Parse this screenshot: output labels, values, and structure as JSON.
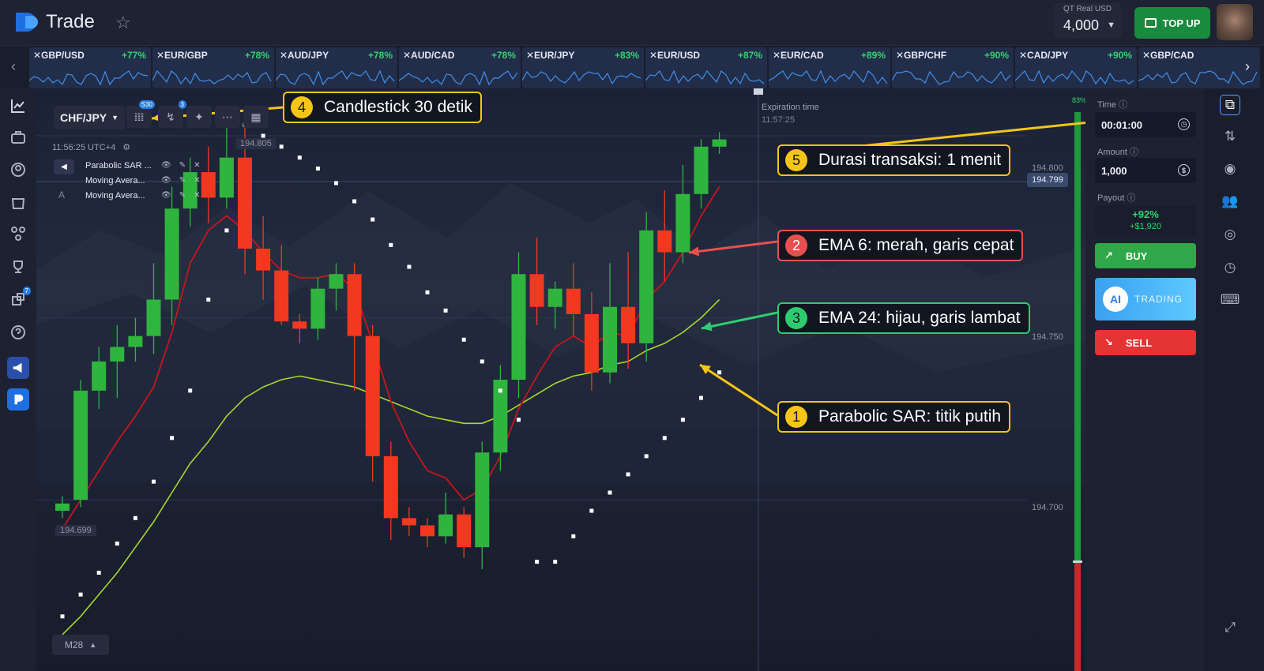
{
  "header": {
    "brand": "Trade",
    "account": {
      "label": "QT Real  USD",
      "balance": "4,000"
    },
    "topup_label": "TOP UP"
  },
  "assets": [
    {
      "name": "GBP/USD",
      "pct": "+77%"
    },
    {
      "name": "EUR/GBP",
      "pct": "+78%"
    },
    {
      "name": "AUD/JPY",
      "pct": "+78%"
    },
    {
      "name": "AUD/CAD",
      "pct": "+78%"
    },
    {
      "name": "EUR/JPY",
      "pct": "+83%"
    },
    {
      "name": "EUR/USD",
      "pct": "+87%"
    },
    {
      "name": "EUR/CAD",
      "pct": "+89%"
    },
    {
      "name": "GBP/CHF",
      "pct": "+90%"
    },
    {
      "name": "CAD/JPY",
      "pct": "+90%"
    },
    {
      "name": "GBP/CAD",
      "pct": ""
    }
  ],
  "sidebar_badges": {
    "notify1": "",
    "notify2": "",
    "count": "7"
  },
  "chart": {
    "pair": "CHF/JPY",
    "tool_badge_1": "S30",
    "tool_badge_2": "3",
    "clock": "11:56:25 UTC+4",
    "indicators": [
      "Parabolic SAR ...",
      "Moving Avera...",
      "Moving Avera..."
    ],
    "indicator_letter": "A",
    "high_tag": "194.805",
    "low_tag": "194.699",
    "current_price": "194.799",
    "price_levels": [
      "194.800",
      "194.750",
      "194.700"
    ],
    "expiration": {
      "label": "Expiration time",
      "time": "11:57:25"
    },
    "timeframe": "M28",
    "sentiment_pct": "83%"
  },
  "annotations": [
    {
      "num": "4",
      "text": "Candlestick 30 detik",
      "color": "#f5c518"
    },
    {
      "num": "5",
      "text": "Durasi transaksi: 1 menit",
      "color": "#f5c518"
    },
    {
      "num": "2",
      "text": "EMA 6: merah, garis cepat",
      "color": "#e85050"
    },
    {
      "num": "3",
      "text": "EMA 24: hijau, garis lambat",
      "color": "#2ecc71"
    },
    {
      "num": "1",
      "text": "Parabolic SAR: titik putih",
      "color": "#f5c518"
    }
  ],
  "trade_panel": {
    "time_label": "Time",
    "time_value": "00:01:00",
    "amount_label": "Amount",
    "amount_value": "1,000",
    "payout_label": "Payout",
    "payout_pct": "+92%",
    "payout_amount": "+$1,920",
    "buy_label": "BUY",
    "ai_label": "AI",
    "ai_sub": "TRADING",
    "sell_label": "SELL"
  },
  "chart_data": {
    "type": "candlestick",
    "series": [
      {
        "name": "Candles",
        "ohlc": [
          [
            194.697,
            194.699,
            194.695,
            194.701
          ],
          [
            194.7,
            194.73,
            194.698,
            194.733
          ],
          [
            194.73,
            194.738,
            194.725,
            194.742
          ],
          [
            194.738,
            194.742,
            194.728,
            194.748
          ],
          [
            194.742,
            194.745,
            194.738,
            194.75
          ],
          [
            194.745,
            194.755,
            194.74,
            194.765
          ],
          [
            194.755,
            194.78,
            194.748,
            194.786
          ],
          [
            194.78,
            194.79,
            194.775,
            194.794
          ],
          [
            194.79,
            194.783,
            194.776,
            194.797
          ],
          [
            194.783,
            194.794,
            194.78,
            194.806
          ],
          [
            194.794,
            194.769,
            194.762,
            194.806
          ],
          [
            194.769,
            194.763,
            194.755,
            194.778
          ],
          [
            194.763,
            194.749,
            194.748,
            194.77
          ],
          [
            194.749,
            194.747,
            194.743,
            194.751
          ],
          [
            194.747,
            194.758,
            194.744,
            194.761
          ],
          [
            194.758,
            194.762,
            194.752,
            194.765
          ],
          [
            194.762,
            194.745,
            194.73,
            194.765
          ],
          [
            194.745,
            194.712,
            194.705,
            194.748
          ],
          [
            194.712,
            194.695,
            194.689,
            194.716
          ],
          [
            194.695,
            194.693,
            194.69,
            194.698
          ],
          [
            194.693,
            194.69,
            194.687,
            194.695
          ],
          [
            194.69,
            194.696,
            194.688,
            194.702
          ],
          [
            194.696,
            194.687,
            194.684,
            194.698
          ],
          [
            194.687,
            194.713,
            194.681,
            194.716
          ],
          [
            194.713,
            194.733,
            194.708,
            194.737
          ],
          [
            194.733,
            194.762,
            194.728,
            194.768
          ],
          [
            194.762,
            194.753,
            194.748,
            194.772
          ],
          [
            194.753,
            194.758,
            194.747,
            194.76
          ],
          [
            194.758,
            194.751,
            194.745,
            194.765
          ],
          [
            194.751,
            194.735,
            194.73,
            194.757
          ],
          [
            194.735,
            194.753,
            194.732,
            194.765
          ],
          [
            194.753,
            194.743,
            194.736,
            194.768
          ],
          [
            194.743,
            194.774,
            194.738,
            194.779
          ],
          [
            194.774,
            194.768,
            194.76,
            194.785
          ],
          [
            194.768,
            194.784,
            194.765,
            194.792
          ],
          [
            194.784,
            194.797,
            194.78,
            194.799
          ],
          [
            194.797,
            194.799,
            194.795,
            194.801
          ]
        ]
      },
      {
        "name": "EMA 6",
        "values": [
          194.692,
          194.7,
          194.708,
          194.716,
          194.723,
          194.731,
          194.746,
          194.765,
          194.774,
          194.778,
          194.774,
          194.768,
          194.763,
          194.761,
          194.761,
          194.762,
          194.758,
          194.743,
          194.727,
          194.716,
          194.708,
          194.706,
          194.7,
          194.703,
          194.712,
          194.725,
          194.734,
          194.742,
          194.745,
          194.742,
          194.746,
          194.745,
          194.755,
          194.76,
          194.768,
          194.778,
          194.786
        ]
      },
      {
        "name": "EMA 24",
        "values": [
          194.663,
          194.668,
          194.674,
          194.68,
          194.687,
          194.694,
          194.702,
          194.71,
          194.716,
          194.723,
          194.728,
          194.731,
          194.733,
          194.734,
          194.733,
          194.732,
          194.731,
          194.729,
          194.727,
          194.725,
          194.723,
          194.722,
          194.721,
          194.721,
          194.723,
          194.726,
          194.729,
          194.732,
          194.734,
          194.735,
          194.737,
          194.738,
          194.741,
          194.743,
          194.746,
          194.75,
          194.755
        ]
      },
      {
        "name": "Parabolic SAR",
        "values": [
          194.668,
          194.674,
          194.68,
          194.688,
          194.695,
          194.705,
          194.717,
          194.73,
          194.755,
          194.774,
          194.803,
          194.8,
          194.797,
          194.794,
          194.791,
          194.787,
          194.782,
          194.777,
          194.77,
          194.764,
          194.757,
          194.752,
          194.744,
          194.738,
          194.73,
          194.722,
          194.683,
          194.683,
          194.69,
          194.697,
          194.702,
          194.707,
          194.712,
          194.717,
          194.722,
          194.728,
          194.735
        ]
      }
    ],
    "ylim": [
      194.653,
      194.813
    ]
  }
}
